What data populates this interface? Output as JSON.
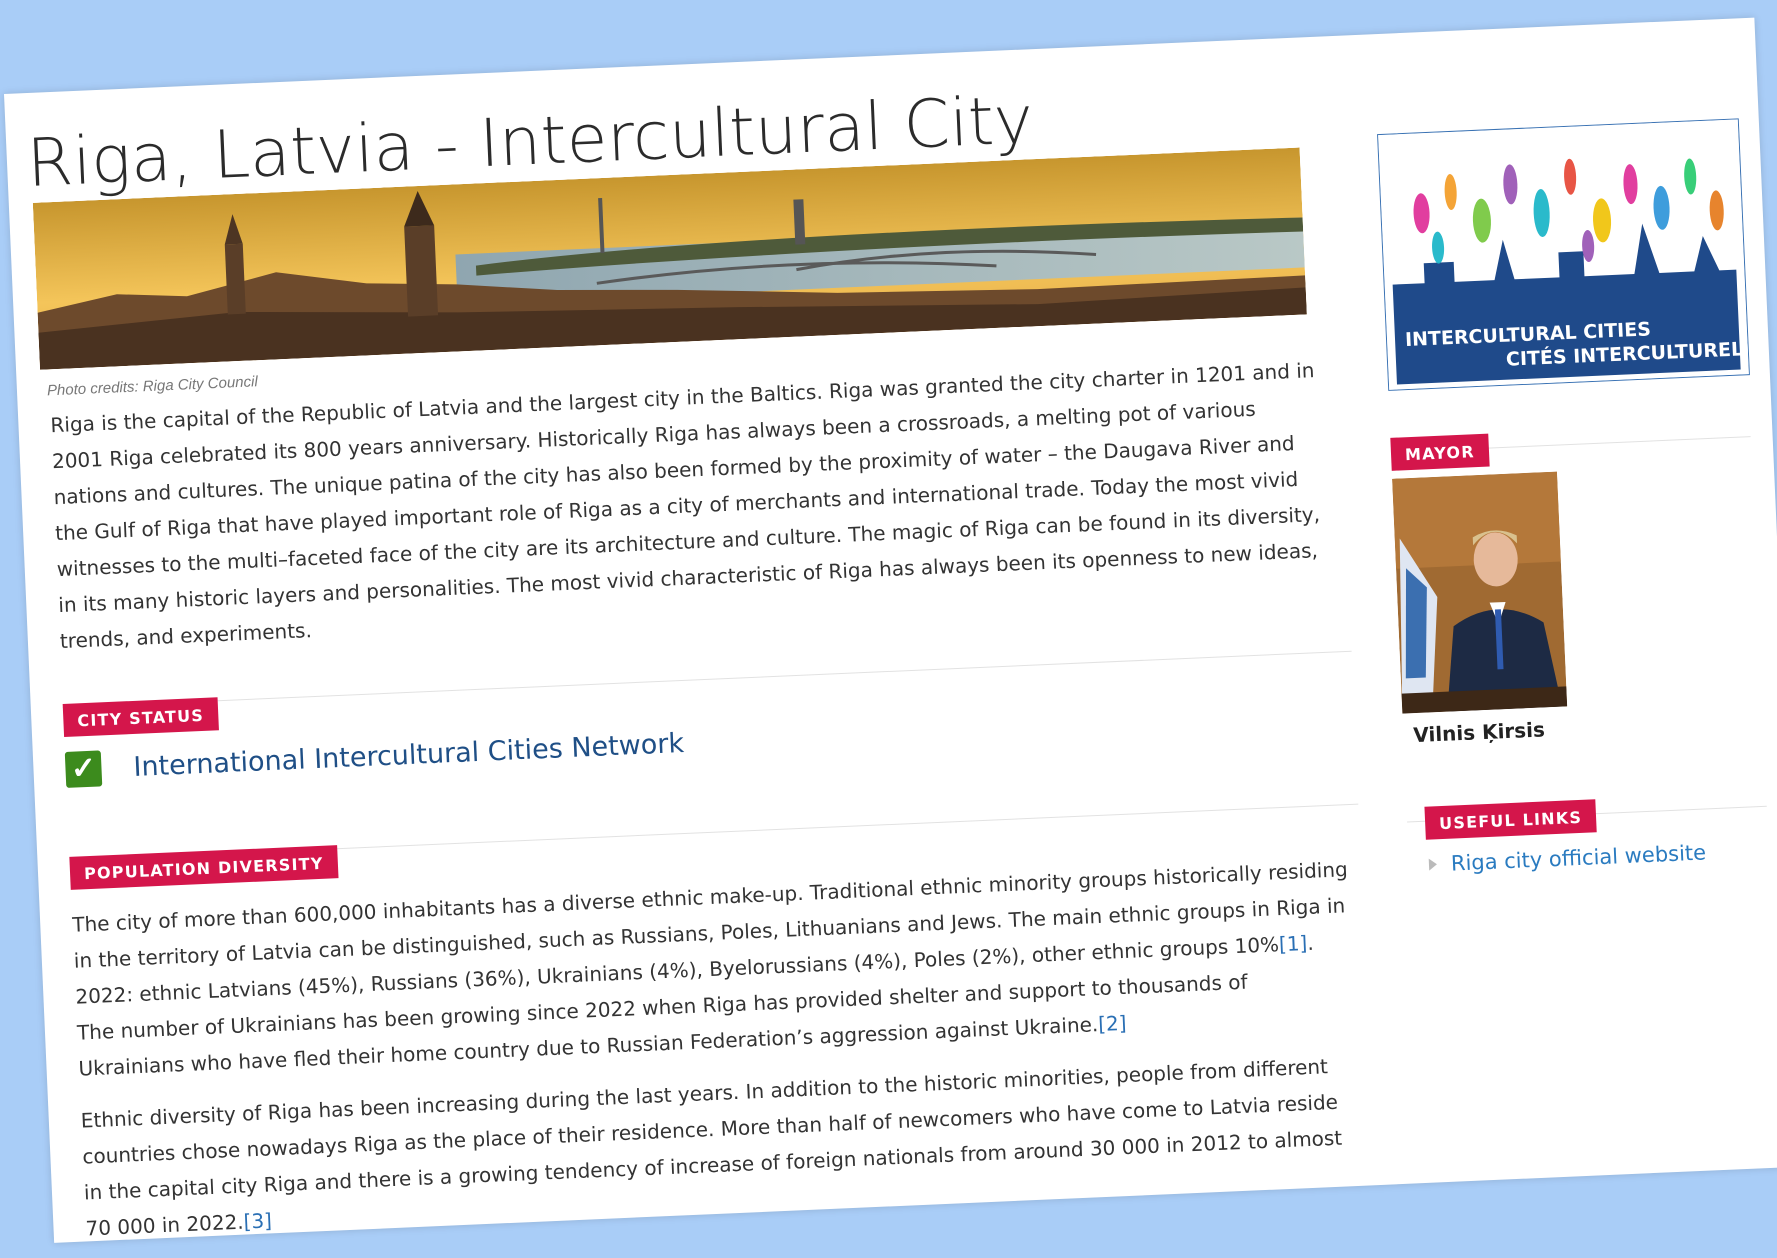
{
  "page": {
    "title": "Riga, Latvia - Intercultural City",
    "photo_credit": "Photo credits: Riga City Council",
    "intro": "Riga is the capital of the Republic of Latvia and the largest city in the Baltics. Riga was granted the city charter in 1201 and in 2001 Riga celebrated its 800 years anniversary. Historically Riga has always been a crossroads, a melting pot of various nations and cultures. The unique patina of the city has also been formed by the proximity of water – the Daugava River and the Gulf of Riga that have played important role of Riga as a city of merchants and international trade. Today the most vivid witnesses to the multi–faceted face of the city are its architecture and culture. The magic of Riga can be found in its diversity, in its many historic layers and personalities. The most vivid characteristic of Riga has always been its openness to new ideas, trends, and experiments."
  },
  "city_status": {
    "heading": "City Status",
    "network_link": "International Intercultural Cities Network"
  },
  "population": {
    "heading": "Population Diversity",
    "p1_text": "The city of more than 600,000 inhabitants has a diverse ethnic make-up. Traditional ethnic minority groups historically residing in the territory of Latvia can be distinguished, such as Russians, Poles, Lithuanians and Jews. The main ethnic groups in Riga in 2022: ethnic Latvians (45%), Russians (36%), Ukrainians (4%), Byelorussians (4%), Poles (2%), other ethnic groups 10%",
    "ref1": "[1]",
    "p1_text2": ". The number of Ukrainians has been growing since 2022 when Riga has provided shelter and support to thousands of Ukrainians who have fled their home country due to Russian Federation’s aggression against Ukraine.",
    "ref2": "[2]",
    "p2_text": "Ethnic diversity of Riga has been increasing during the last years. In addition to the historic minorities, people from different countries chose nowadays Riga as the place of their residence. More than half of newcomers who have come to Latvia reside in the capital city Riga and there is a growing tendency of increase of foreign nationals from around 30 000 in 2012 to almost 70 000 in 2022.",
    "ref3": "[3]"
  },
  "sidebar": {
    "logo_line1": "INTERCULTURAL CITIES",
    "logo_line2": "CITÉS INTERCULTURELLES",
    "mayor_heading": "Mayor",
    "mayor_name": "Vilnis Ķirsis",
    "links_heading": "Useful links",
    "links": [
      {
        "label": "Riga city official website"
      }
    ]
  },
  "colors": {
    "tag_red": "#d4164b",
    "link_blue": "#2a7bc0",
    "check_green": "#3c8b1d",
    "background": "#a9cdf7"
  }
}
